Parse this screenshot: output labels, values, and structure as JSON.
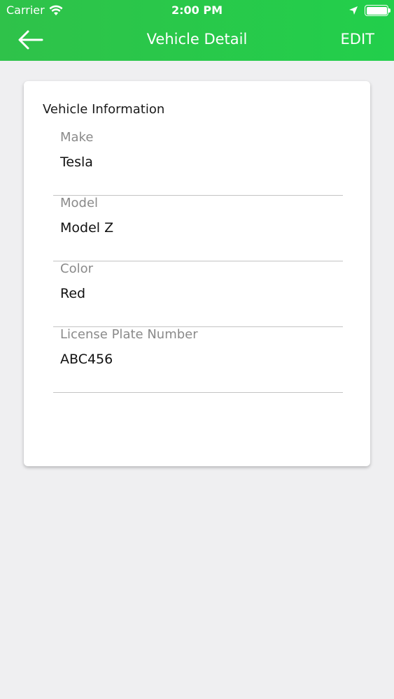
{
  "status_bar": {
    "carrier": "Carrier",
    "time": "2:00 PM",
    "icons": [
      "wifi-icon",
      "location-arrow-icon",
      "battery-icon"
    ]
  },
  "header": {
    "title": "Vehicle Detail",
    "edit_label": "EDIT",
    "back_icon": "arrow-left-icon",
    "color": "#2ccb4a"
  },
  "card": {
    "section_title": "Vehicle Information",
    "fields": [
      {
        "label": "Make",
        "value": "Tesla"
      },
      {
        "label": "Model",
        "value": "Model Z"
      },
      {
        "label": "Color",
        "value": "Red"
      },
      {
        "label": "License Plate Number",
        "value": "ABC456"
      }
    ]
  }
}
